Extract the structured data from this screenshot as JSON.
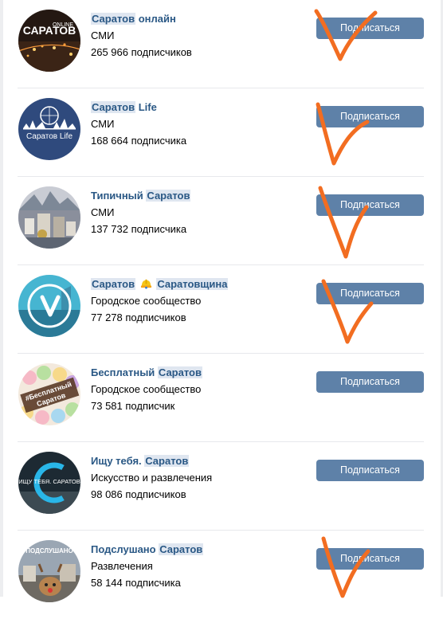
{
  "subscribe_label": "Подписаться",
  "colors": {
    "link": "#2a5885",
    "button": "#5e81a8",
    "highlight": "#dfe6f0",
    "checkmark": "#f26d21"
  },
  "groups": [
    {
      "name_parts": [
        "Саратов",
        " онлайн"
      ],
      "category": "СМИ",
      "subscribers": "265 966 подписчиков",
      "avatar_text": "САРАТОВ",
      "avatar_text_small": "ONLINE",
      "checked": true
    },
    {
      "name_parts": [
        "Саратов",
        " Life"
      ],
      "category": "СМИ",
      "subscribers": "168 664 подписчика",
      "avatar_text": "Саратов Life",
      "checked": true
    },
    {
      "name_parts": [
        "Типичный ",
        "Саратов"
      ],
      "category": "СМИ",
      "subscribers": "137 732 подписчика",
      "checked": true
    },
    {
      "name_parts": [
        "Саратов",
        " ",
        "Саратовщина"
      ],
      "category": "Городское сообщество",
      "subscribers": "77 278 подписчиков",
      "emoji": "hard-hat-emoji",
      "checked": true
    },
    {
      "name_parts": [
        "Бесплатный ",
        "Саратов"
      ],
      "category": "Городское сообщество",
      "subscribers": "73 581 подписчик",
      "avatar_text": "#Бесплатный",
      "avatar_text_small": "Саратов",
      "checked": false
    },
    {
      "name_parts": [
        "Ищу тебя. ",
        "Саратов"
      ],
      "category": "Искусство и развлечения",
      "subscribers": "98 086 подписчиков",
      "avatar_text": "ИЩУ ТЕБЯ. САРАТОВ",
      "checked": false
    },
    {
      "name_parts": [
        "Подслушано ",
        "Саратов"
      ],
      "category": "Развлечения",
      "subscribers": "58 144 подписчика",
      "avatar_text": "ПОДСЛУШАНО",
      "checked": true
    }
  ]
}
